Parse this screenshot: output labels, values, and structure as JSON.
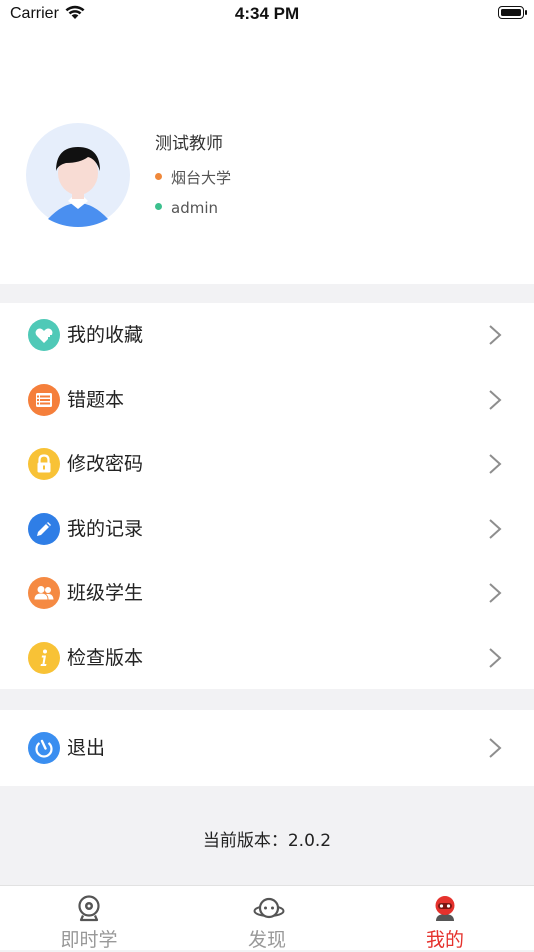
{
  "status_bar": {
    "carrier": "Carrier",
    "time": "4:34 PM"
  },
  "profile": {
    "name": "测试教师",
    "school": "烟台大学",
    "account": "admin",
    "school_dot_color": "#f0883a",
    "account_dot_color": "#3cc08e"
  },
  "menu": {
    "items": [
      {
        "label": "我的收藏",
        "icon": "heart-plus-icon",
        "color": "#4fc9b7"
      },
      {
        "label": "错题本",
        "icon": "list-book-icon",
        "color": "#f57f3b"
      },
      {
        "label": "修改密码",
        "icon": "lock-icon",
        "color": "#f8c236"
      },
      {
        "label": "我的记录",
        "icon": "pencil-icon",
        "color": "#2f7ee6"
      },
      {
        "label": "班级学生",
        "icon": "users-icon",
        "color": "#f58a43"
      },
      {
        "label": "检查版本",
        "icon": "info-icon",
        "color": "#f8c236"
      }
    ],
    "logout": {
      "label": "退出",
      "icon": "power-icon",
      "color": "#3a8ef0"
    }
  },
  "version": {
    "text": "当前版本：2.0.2"
  },
  "tab_bar": {
    "tabs": [
      {
        "label": "即时学",
        "icon": "webcam-icon",
        "active": false
      },
      {
        "label": "发现",
        "icon": "planet-icon",
        "active": false
      },
      {
        "label": "我的",
        "icon": "robot-icon",
        "active": true
      }
    ],
    "active_color": "#e5322d",
    "inactive_color": "#999999"
  }
}
